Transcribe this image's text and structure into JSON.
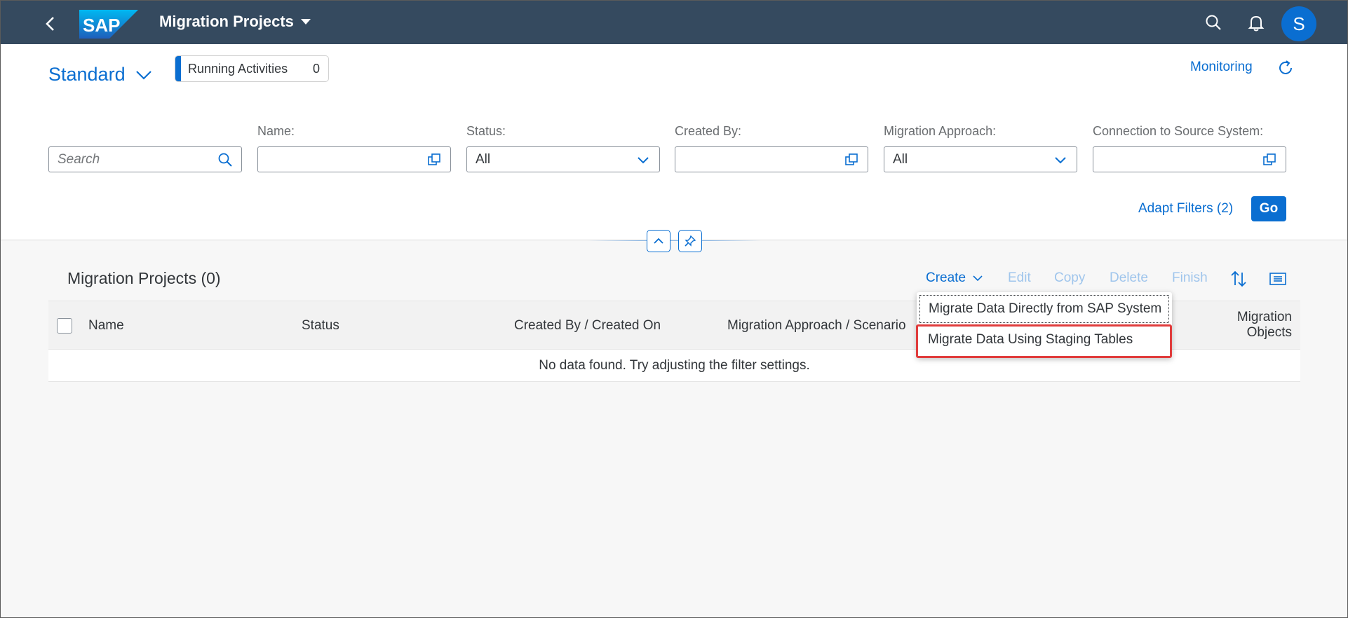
{
  "shell": {
    "brand": "SAP",
    "title": "Migration Projects",
    "avatar_initial": "S",
    "colors": {
      "background": "#354a5f",
      "avatar": "#0a6ed1"
    }
  },
  "header": {
    "variant": "Standard",
    "running_activities": {
      "label": "Running Activities",
      "count": "0"
    },
    "monitoring": "Monitoring"
  },
  "filters": {
    "search_placeholder": "Search",
    "name_label": "Name:",
    "name_value": "",
    "status_label": "Status:",
    "status_value": "All",
    "created_by_label": "Created By:",
    "created_by_value": "",
    "approach_label": "Migration Approach:",
    "approach_value": "All",
    "connection_label": "Connection to Source System:",
    "connection_value": "",
    "adapt_filters": "Adapt Filters (2)",
    "go": "Go"
  },
  "table": {
    "title": "Migration Projects (0)",
    "toolbar": {
      "create": "Create",
      "edit": "Edit",
      "copy": "Copy",
      "delete": "Delete",
      "finish": "Finish"
    },
    "columns": {
      "name": "Name",
      "status": "Status",
      "created": "Created By / Created On",
      "approach": "Migration Approach / Scenario",
      "objects_line1": "Migration",
      "objects_line2": "Objects"
    },
    "no_data": "No data found. Try adjusting the filter settings."
  },
  "create_menu": {
    "items": [
      "Migrate Data Directly from SAP System",
      "Migrate Data Using Staging Tables"
    ],
    "highlighted_index": 1,
    "highlight_color": "#e03c3c"
  },
  "accent_color": "#0a6ed1"
}
